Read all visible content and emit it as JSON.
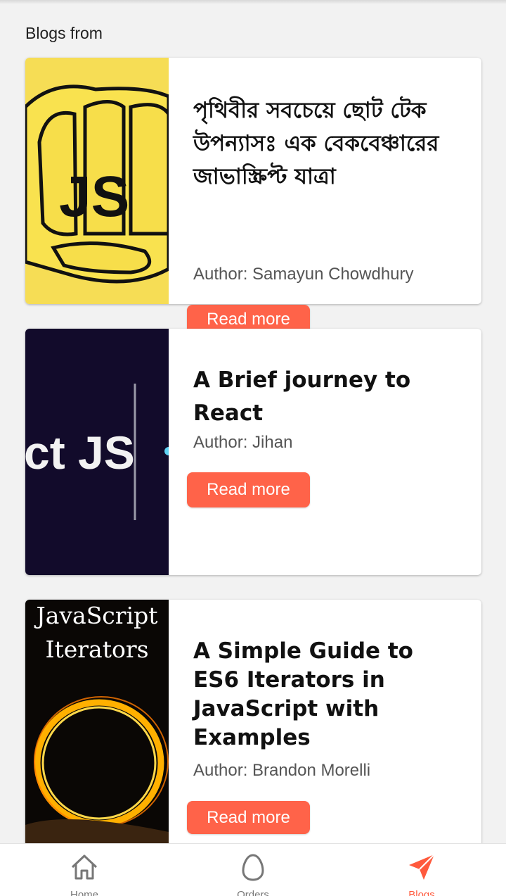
{
  "section_title": "Blogs from",
  "blogs": [
    {
      "title": "পৃথিবীর সবচেয়ে ছোট টেক উপন্যাসঃ এক বেকবেঞ্চারের জাভাস্ক্রিপ্ট যাত্রা",
      "author": "Author: Samayun Chowdhury",
      "button": "Read more",
      "thumb_text": "JS"
    },
    {
      "title": "A Brief journey to React",
      "author": "Author: Jihan",
      "button": "Read more",
      "thumb_text": "ct JS"
    },
    {
      "title": "A Simple Guide to ES6 Iterators in JavaScript with Examples",
      "author": "Author: Brandon Morelli",
      "button": "Read more",
      "thumb_line1": "JavaScript",
      "thumb_line2": "Iterators"
    }
  ],
  "nav": {
    "items": [
      {
        "label": "Home",
        "icon": "home-icon"
      },
      {
        "label": "Orders",
        "icon": "egg-icon"
      },
      {
        "label": "Blogs",
        "icon": "send-icon"
      }
    ],
    "active": "Blogs"
  },
  "colors": {
    "accent": "#ff6349",
    "background": "#f2f2f2",
    "card": "#ffffff"
  }
}
